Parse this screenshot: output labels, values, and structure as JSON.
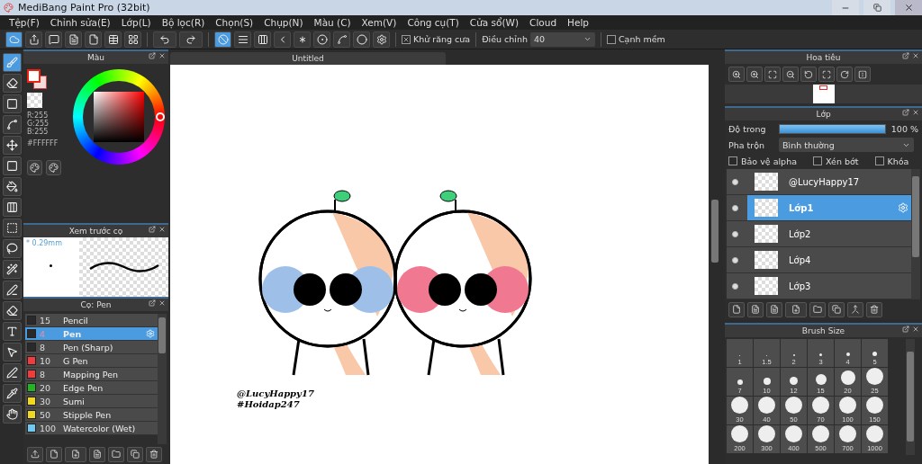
{
  "window": {
    "title": "MediBang Paint Pro (32bit)"
  },
  "menu": [
    "Tệp(F)",
    "Chỉnh sửa(E)",
    "Lớp(L)",
    "Bộ lọc(R)",
    "Chọn(S)",
    "Chụp(N)",
    "Màu (C)",
    "Xem(V)",
    "Công cụ(T)",
    "Cửa sổ(W)",
    "Cloud",
    "Help"
  ],
  "snaps": [
    {
      "selected": true
    },
    {
      "selected": false
    },
    {
      "selected": false
    },
    {
      "selected": false
    },
    {
      "selected": false
    },
    {
      "selected": false
    },
    {
      "selected": false
    },
    {
      "selected": false
    },
    {
      "selected": false
    }
  ],
  "antialias": {
    "label": "Khử răng cưa",
    "checked": true
  },
  "adjust": {
    "label": "Điều chỉnh",
    "value": "40"
  },
  "soft_edge": {
    "label": "Cạnh mềm",
    "checked": false
  },
  "tools": [
    {
      "selected": true
    },
    {
      "selected": false
    },
    {
      "selected": false
    },
    {
      "selected": false
    },
    {
      "selected": false
    },
    {
      "selected": false
    },
    {
      "selected": false
    },
    {
      "selected": false
    },
    {
      "selected": false
    },
    {
      "selected": false
    },
    {
      "selected": false
    },
    {
      "selected": false
    },
    {
      "selected": false
    },
    {
      "selected": false
    },
    {
      "selected": false
    },
    {
      "selected": false
    },
    {
      "selected": false
    },
    {
      "selected": false
    }
  ],
  "color_panel": {
    "title": "Màu",
    "rgb": [
      "R:255",
      "G:255",
      "B:255"
    ],
    "hex": "#FFFFFF"
  },
  "brush_preview": {
    "title": "Xem trước cọ",
    "size": "* 0.29mm"
  },
  "brush_panel": {
    "title": "Cọ: Pen",
    "brushes": [
      {
        "size": "15",
        "name": "Pencil",
        "color": "#2a2a2a",
        "selected": false
      },
      {
        "size": "4",
        "name": "Pen",
        "color": "#2a2a2a",
        "selected": true
      },
      {
        "size": "8",
        "name": "Pen (Sharp)",
        "color": "#2a2a2a",
        "selected": false
      },
      {
        "size": "10",
        "name": "G Pen",
        "color": "#f03c3c",
        "selected": false
      },
      {
        "size": "8",
        "name": "Mapping Pen",
        "color": "#f03c3c",
        "selected": false
      },
      {
        "size": "20",
        "name": "Edge Pen",
        "color": "#22b422",
        "selected": false
      },
      {
        "size": "30",
        "name": "Sumi",
        "color": "#f0d820",
        "selected": false
      },
      {
        "size": "50",
        "name": "Stipple Pen",
        "color": "#f0d820",
        "selected": false
      },
      {
        "size": "100",
        "name": "Watercolor (Wet)",
        "color": "#70c8f0",
        "selected": false
      }
    ]
  },
  "document": {
    "tab": "Untitled",
    "signature": [
      "@LucyHappy17",
      "#Hoidap247"
    ]
  },
  "navigator": {
    "title": "Hoa tiêu"
  },
  "layer_panel": {
    "title": "Lớp",
    "opacity_label": "Độ trong",
    "opacity": {
      "level": 1
    },
    "opacity_reading": "100 %",
    "blend_label": "Pha trộn",
    "blend": "Bình thường",
    "locks": [
      {
        "label": "Bảo vệ alpha",
        "checked": false
      },
      {
        "label": "Xén bớt",
        "checked": false
      },
      {
        "label": "Khóa",
        "checked": false
      }
    ],
    "layers": [
      {
        "name": "@LucyHappy17",
        "selected": false,
        "visible": true
      },
      {
        "name": "Lớp1",
        "selected": true,
        "visible": true
      },
      {
        "name": "Lớp2",
        "selected": false,
        "visible": true
      },
      {
        "name": "Lớp4",
        "selected": false,
        "visible": true
      },
      {
        "name": "Lớp3",
        "selected": false,
        "visible": true
      }
    ]
  },
  "brush_size": {
    "title": "Brush Size",
    "sizes": [
      "1",
      "1.5",
      "2",
      "3",
      "4",
      "5",
      "7",
      "10",
      "12",
      "15",
      "20",
      "25",
      "30",
      "40",
      "50",
      "70",
      "100",
      "150",
      "200",
      "300",
      "400",
      "500",
      "700",
      "1000"
    ]
  }
}
